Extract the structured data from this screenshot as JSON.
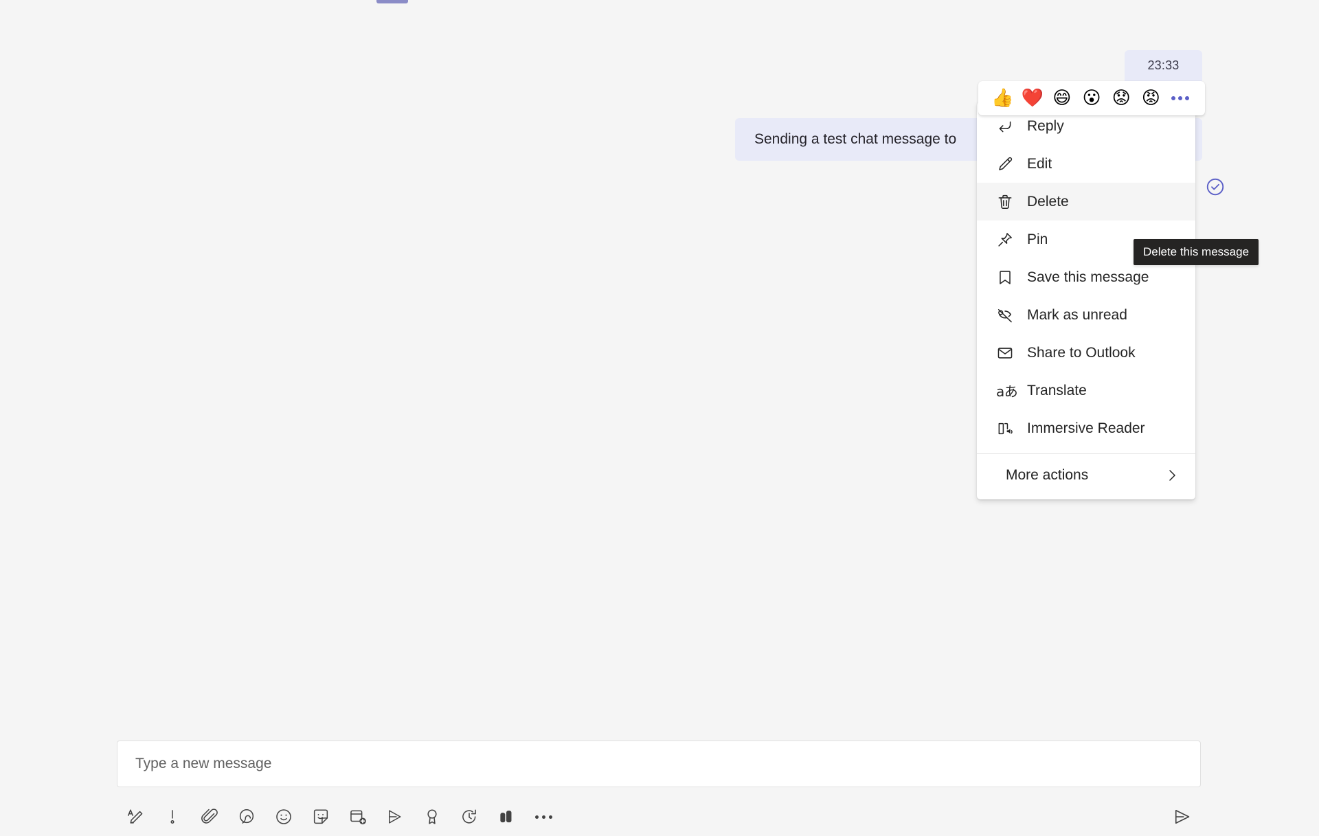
{
  "message": {
    "timestamp": "23:33",
    "text": "Sending a test chat message to",
    "status_icon": "circle-check-icon"
  },
  "reactions": {
    "items": [
      {
        "name": "thumbs-up-reaction",
        "glyph": "👍"
      },
      {
        "name": "heart-reaction",
        "glyph": "❤️"
      },
      {
        "name": "laugh-reaction",
        "glyph": "😄"
      },
      {
        "name": "surprised-reaction",
        "glyph": "😮"
      },
      {
        "name": "sad-reaction",
        "glyph": "😟"
      },
      {
        "name": "angry-reaction",
        "glyph": "😡"
      }
    ],
    "more_label": "More reactions"
  },
  "context_menu": {
    "items": [
      {
        "label": "Reply",
        "icon": "reply-arrow-icon",
        "selected": false
      },
      {
        "label": "Edit",
        "icon": "pencil-icon",
        "selected": false
      },
      {
        "label": "Delete",
        "icon": "trash-icon",
        "selected": true
      },
      {
        "label": "Pin",
        "icon": "pin-icon",
        "selected": false
      },
      {
        "label": "Save this message",
        "icon": "bookmark-icon",
        "selected": false
      },
      {
        "label": "Mark as unread",
        "icon": "mark-unread-icon",
        "selected": false
      },
      {
        "label": "Share to Outlook",
        "icon": "envelope-icon",
        "selected": false
      },
      {
        "label": "Translate",
        "icon": "translate-icon",
        "selected": false
      },
      {
        "label": "Immersive Reader",
        "icon": "immersive-reader-icon",
        "selected": false
      }
    ],
    "more_actions": {
      "label": "More actions",
      "icon": "chevron-right-icon"
    }
  },
  "tooltip": {
    "text": "Delete this message"
  },
  "compose": {
    "placeholder": "Type a new message",
    "value": "",
    "send_label": "Send"
  },
  "toolbar": {
    "items": [
      {
        "name": "format-icon",
        "label": "Format"
      },
      {
        "name": "important-icon",
        "label": "Set delivery options"
      },
      {
        "name": "attach-icon",
        "label": "Attach"
      },
      {
        "name": "loop-component-icon",
        "label": "Loop component"
      },
      {
        "name": "emoji-icon",
        "label": "Emoji"
      },
      {
        "name": "sticker-icon",
        "label": "Sticker"
      },
      {
        "name": "meet-now-icon",
        "label": "Schedule a meeting"
      },
      {
        "name": "stream-icon",
        "label": "Stream"
      },
      {
        "name": "praise-icon",
        "label": "Praise"
      },
      {
        "name": "loop-refresh-icon",
        "label": "Updates"
      },
      {
        "name": "approvals-icon",
        "label": "Approvals"
      },
      {
        "name": "more-options-icon",
        "label": "More options"
      }
    ]
  },
  "colors": {
    "background": "#f5f5f5",
    "bubble": "#e8eaf8",
    "accent": "#5b5fc7",
    "tooltip_bg": "#252423",
    "menu_bg": "#ffffff",
    "menu_selected": "#f5f5f5",
    "text": "#242424"
  }
}
